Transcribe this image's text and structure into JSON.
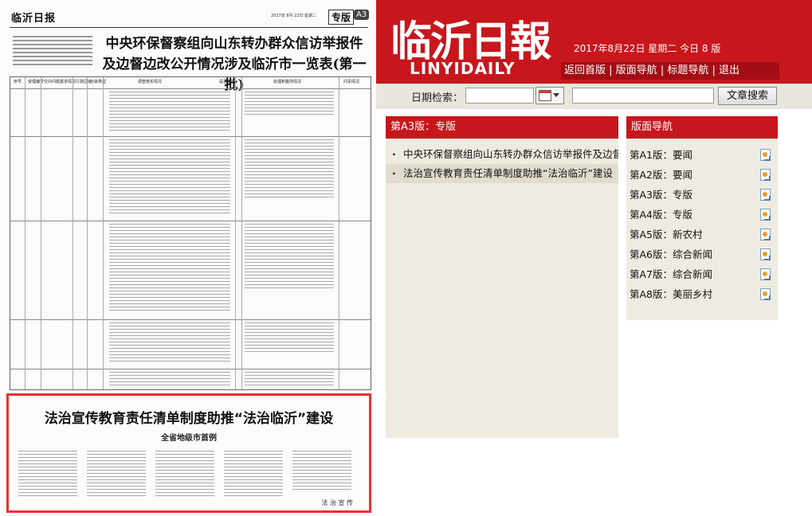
{
  "paper": {
    "masthead": "临沂日报",
    "date_line": "2017年 8月 22日  星期二",
    "edition_label": "专版",
    "page_tag": "A3",
    "headline_line1": "中央环保督察组向山东转办群众信访举报件",
    "headline_line2": "及边督边改公开情况涉及临沂市一览表(第一批)",
    "table_headers": [
      "序号",
      "受理编号",
      "交办问题基本情况",
      "行政区域",
      "污染类型",
      "调查核实情况",
      "是否属实",
      "处理和整改情况",
      "问责情况"
    ],
    "highlight_title": "法治宣传教育责任清单制度助推“法治临沂”建设",
    "highlight_sub": "全省地级市首例",
    "highlight_foot": "法 治 宣 传"
  },
  "header": {
    "logo_cn": "临沂日報",
    "logo_en": "LINYIDAILY",
    "date_text": "2017年8月22日   星期二   今日 8 版",
    "nav": [
      "返回首版",
      "版面导航",
      "标题导航",
      "退出"
    ]
  },
  "search": {
    "label": "日期检索：",
    "button": "文章搜索"
  },
  "article_panel": {
    "title": "第A3版：专版",
    "items": [
      "中央环保督察组向山东转办群众信访举报件及边督边改公开情况涉及临沂市一览表(第一批)",
      "法治宣传教育责任清单制度助推“法治临沂”建设"
    ]
  },
  "edition_panel": {
    "title": "版面导航",
    "items": [
      "第A1版：要闻",
      "第A2版：要闻",
      "第A3版：专版",
      "第A4版：专版",
      "第A5版：新农村",
      "第A6版：综合新闻",
      "第A7版：综合新闻",
      "第A8版：美丽乡村"
    ]
  },
  "colors": {
    "brand_red": "#c8161d",
    "panel_bg": "#efebe2",
    "highlight_border": "#e8322e"
  },
  "icons": {
    "edition_item": "pdf-icon",
    "calendar": "calendar-icon"
  }
}
